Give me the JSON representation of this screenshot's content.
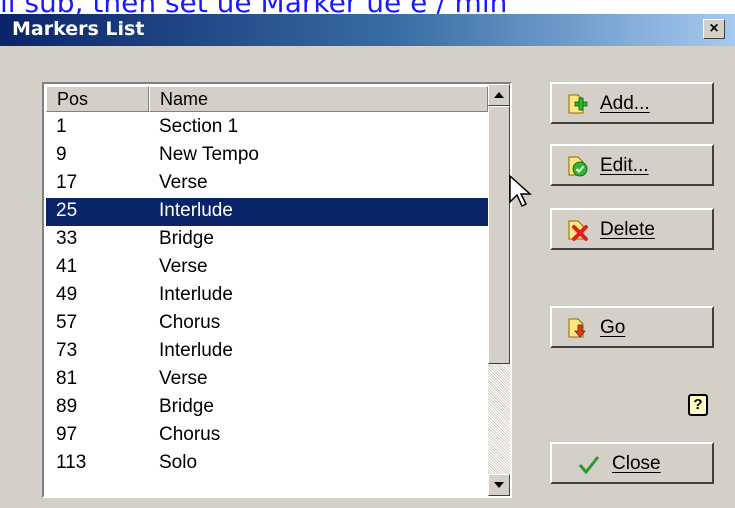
{
  "background_text": "ll sub, then set ue Marker ue e / min",
  "dialog": {
    "title": "Markers List",
    "close_glyph": "×"
  },
  "list": {
    "columns": [
      "Pos",
      "Name"
    ],
    "rows": [
      {
        "pos": "1",
        "name": "Section 1"
      },
      {
        "pos": "9",
        "name": "New Tempo"
      },
      {
        "pos": "17",
        "name": "Verse"
      },
      {
        "pos": "25",
        "name": "Interlude"
      },
      {
        "pos": "33",
        "name": "Bridge"
      },
      {
        "pos": "41",
        "name": "Verse"
      },
      {
        "pos": "49",
        "name": "Interlude"
      },
      {
        "pos": "57",
        "name": "Chorus"
      },
      {
        "pos": "73",
        "name": "Interlude"
      },
      {
        "pos": "81",
        "name": "Verse"
      },
      {
        "pos": "89",
        "name": "Bridge"
      },
      {
        "pos": "97",
        "name": "Chorus"
      },
      {
        "pos": "113",
        "name": "Solo"
      }
    ],
    "selected_index": 3
  },
  "buttons": {
    "add": "Add...",
    "edit": "Edit...",
    "delete": "Delete",
    "go": "Go",
    "close": "Close"
  },
  "help_glyph": "?",
  "colors": {
    "selection": "#0a246a",
    "titlebar": "#0a246a",
    "dialog_bg": "#d4d0c8"
  },
  "icons": [
    "add-marker-icon",
    "edit-check-icon",
    "delete-x-icon",
    "go-arrow-icon",
    "checkmark-icon",
    "help-icon",
    "mouse-cursor-icon"
  ]
}
